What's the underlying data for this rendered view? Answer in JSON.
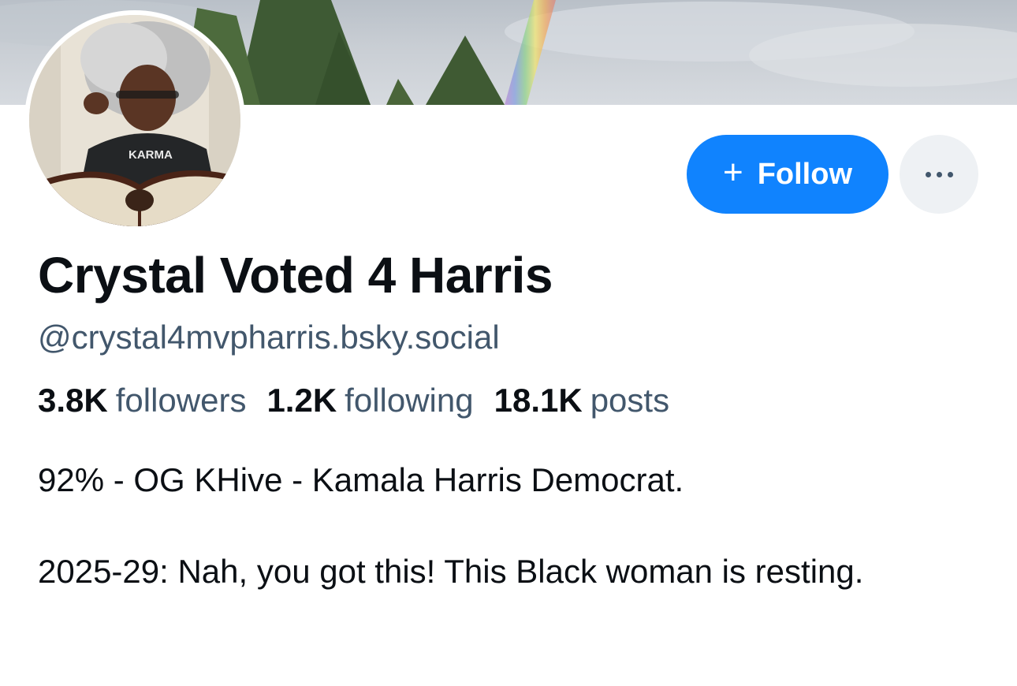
{
  "profile": {
    "display_name": "Crystal Voted 4 Harris",
    "handle": "@crystal4mvpharris.bsky.social",
    "avatar_text": "KARMA"
  },
  "actions": {
    "follow_label": "Follow",
    "plus_icon": "+",
    "more_icon": "ellipsis-icon"
  },
  "stats": {
    "followers_count": "3.8K",
    "followers_label": "followers",
    "following_count": "1.2K",
    "following_label": "following",
    "posts_count": "18.1K",
    "posts_label": "posts"
  },
  "bio": {
    "line1": "92% - OG KHive - Kamala Harris Democrat.",
    "line2": "2025-29: Nah, you got this! This Black woman is resting."
  },
  "colors": {
    "accent": "#1083fe",
    "muted_text": "#42576c",
    "more_button_bg": "#eef1f4"
  }
}
